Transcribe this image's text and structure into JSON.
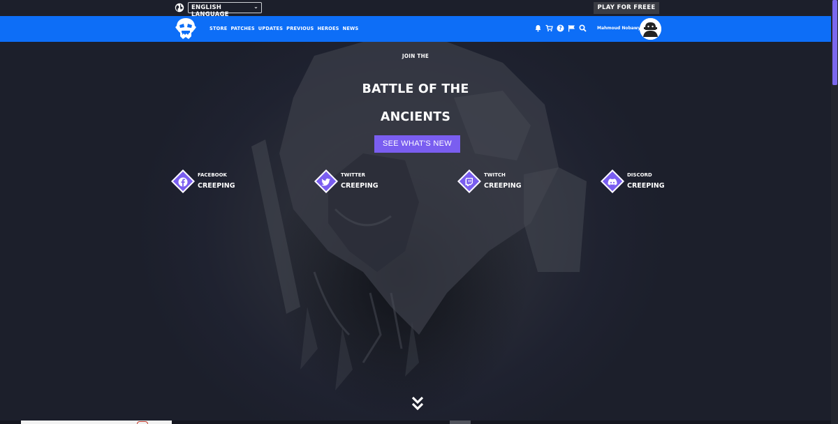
{
  "topbar": {
    "language_label": "ENGLISH LANGUAGE",
    "play_label": "PLAY FOR FREEE"
  },
  "nav": {
    "links": [
      "STORE",
      "PATCHES",
      "UPDATES",
      "PREVIOUS",
      "HEROES",
      "NEWS"
    ],
    "icons": [
      "bell-icon",
      "cart-icon",
      "help-icon",
      "flag-icon",
      "search-icon"
    ],
    "username": "Mahmoud Nobawy"
  },
  "hero": {
    "kicker": "JOIN THE",
    "title_line1": "BATTLE OF THE",
    "title_line2": "ANCIENTS",
    "cta_label": "SEE WHAT'S NEW"
  },
  "socials": [
    {
      "name": "FACEBOOK",
      "sub": "CREEPING",
      "icon": "facebook-icon"
    },
    {
      "name": "TWITTER",
      "sub": "CREEPING",
      "icon": "twitter-icon"
    },
    {
      "name": "TWITCH",
      "sub": "CREEPING",
      "icon": "twitch-icon"
    },
    {
      "name": "DISCORD",
      "sub": "CREEPING",
      "icon": "discord-icon"
    }
  ],
  "colors": {
    "nav_bg": "#0d6ef7",
    "accent": "#7a5ef0",
    "page_bg": "#1c1f2b",
    "play_btn_bg": "#3a3c44"
  }
}
